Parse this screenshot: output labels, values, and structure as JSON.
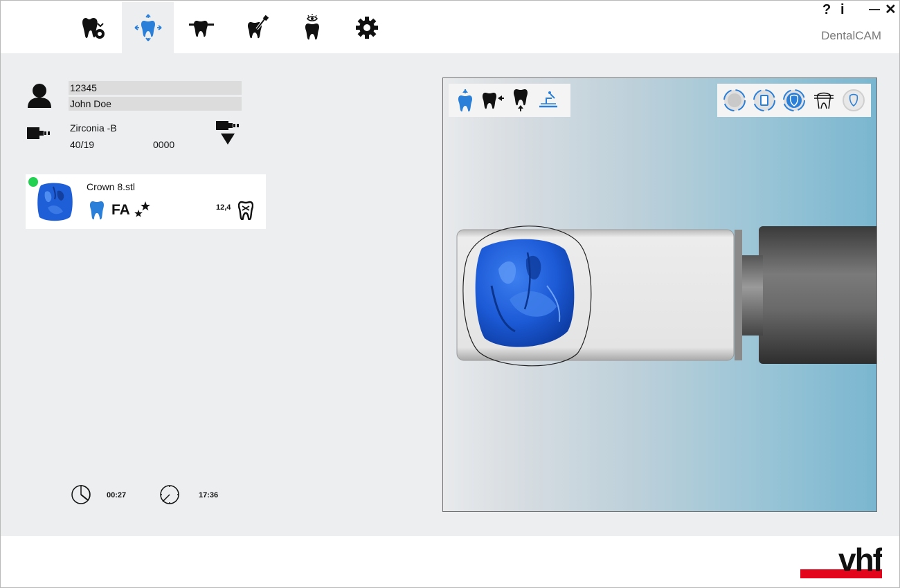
{
  "app": {
    "brand": "DentalCAM",
    "help_label": "?",
    "info_label": "i",
    "minimize_label": "—",
    "close_label": "✕"
  },
  "nav": [
    {
      "name": "job-settings",
      "icon": "tooth-gear-icon"
    },
    {
      "name": "positioning",
      "icon": "tooth-move-icon",
      "active": true
    },
    {
      "name": "blank-holder",
      "icon": "tooth-connector-icon"
    },
    {
      "name": "milling",
      "icon": "tooth-tool-icon"
    },
    {
      "name": "preview",
      "icon": "tooth-eye-icon"
    },
    {
      "name": "settings",
      "icon": "gear-icon"
    }
  ],
  "patient": {
    "id": "12345",
    "name": "John Doe"
  },
  "material": {
    "name": "Zirconia -B",
    "size": "40/19",
    "batch": "0000"
  },
  "job": {
    "filename": "Crown 8.stl",
    "type_code": "FA",
    "value": "12,4",
    "status_color": "#22d052"
  },
  "timers": {
    "duration": "00:27",
    "finish_time": "17:36"
  },
  "colors": {
    "accent": "#2a7fd9",
    "crown": "#1e5fd8",
    "logo_red": "#e3051b"
  },
  "logo_text": "vhf"
}
